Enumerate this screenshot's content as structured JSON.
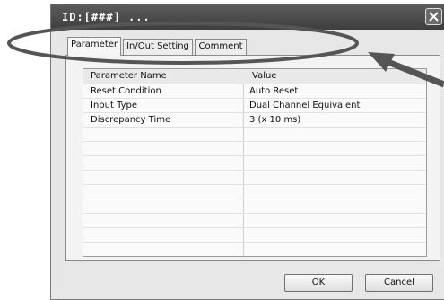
{
  "window": {
    "title": "ID:[###] ..."
  },
  "tabs": [
    {
      "label": "Parameter"
    },
    {
      "label": "In/Out Setting"
    },
    {
      "label": "Comment"
    }
  ],
  "table": {
    "columns": [
      "Parameter Name",
      "Value"
    ],
    "rows": [
      [
        "Reset Condition",
        "Auto Reset"
      ],
      [
        "Input Type",
        "Dual Channel Equivalent"
      ],
      [
        "Discrepancy Time",
        "3 (x 10 ms)"
      ]
    ]
  },
  "buttons": {
    "ok": "OK",
    "cancel": "Cancel"
  },
  "colors": {
    "annotation": "#555555",
    "titlebar": "#4a4a4a"
  }
}
